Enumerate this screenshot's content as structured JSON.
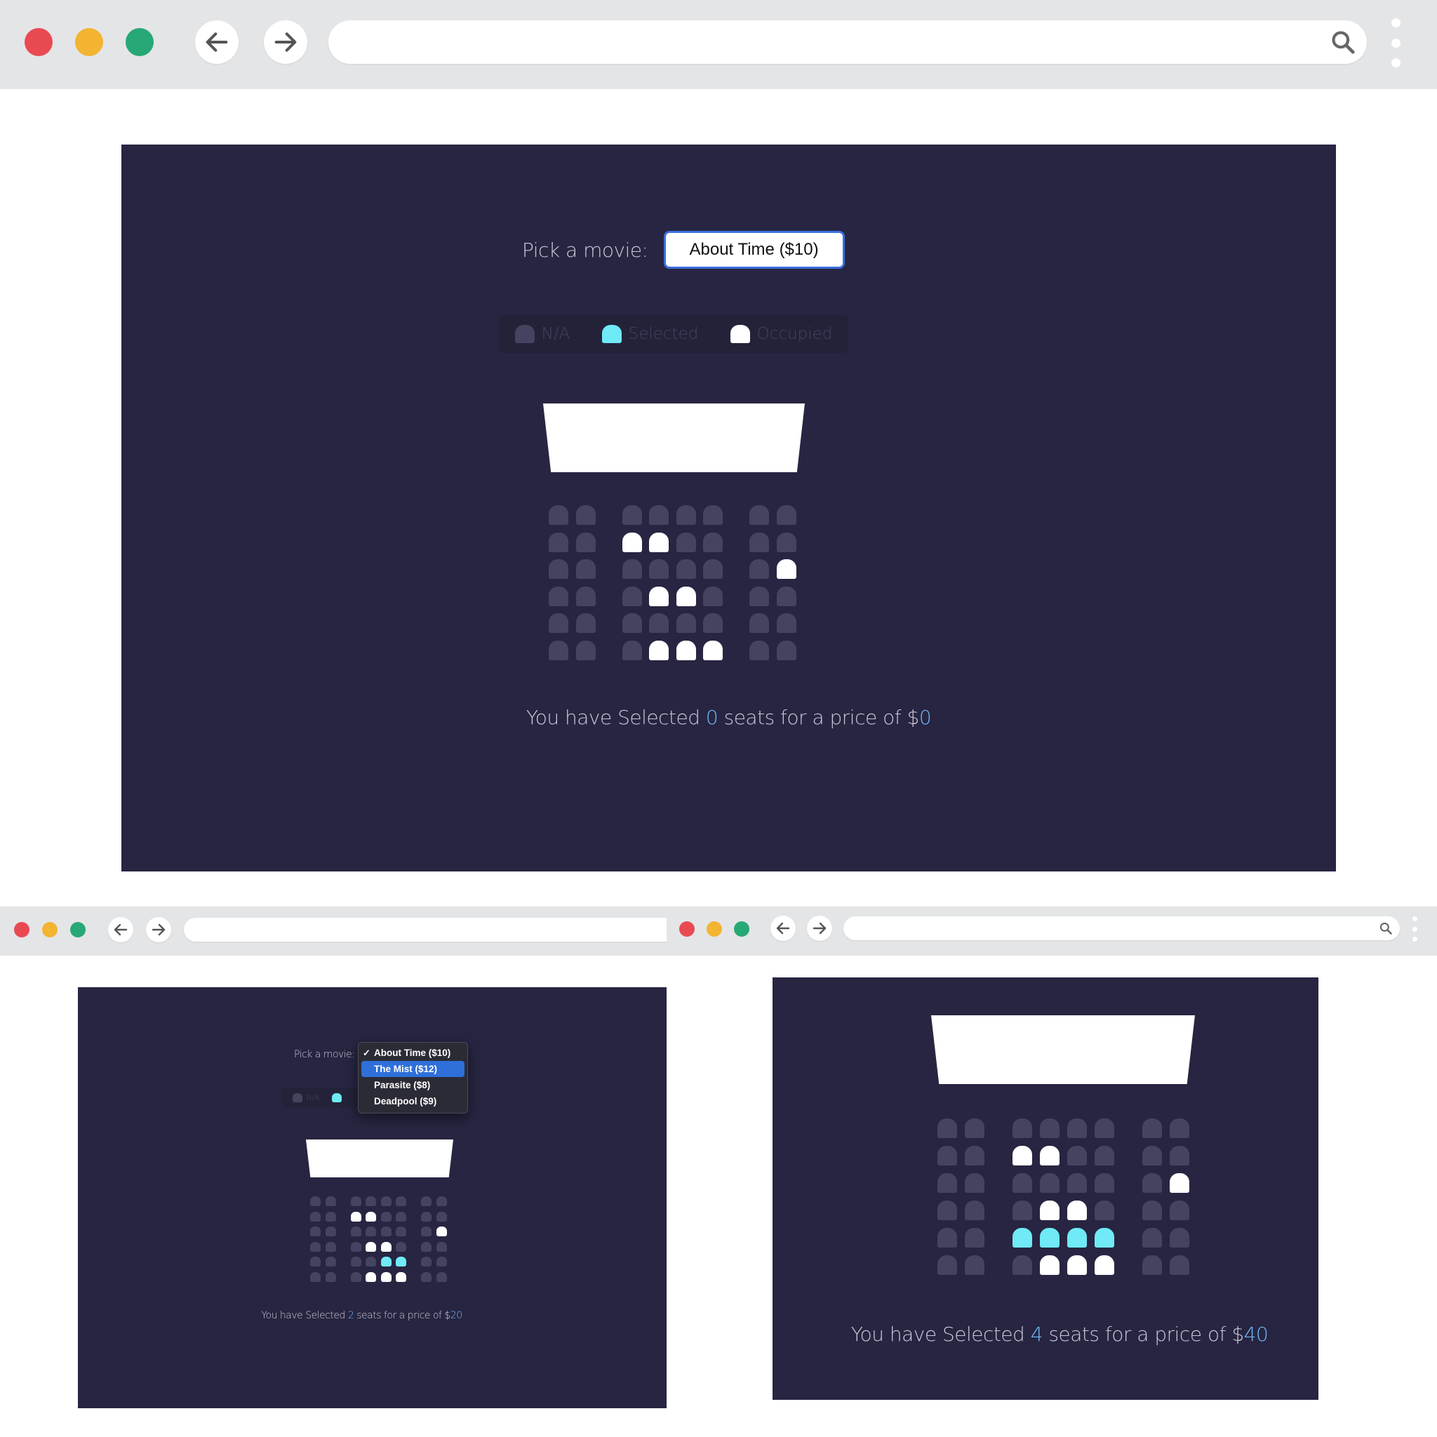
{
  "colors": {
    "close": "#e94a52",
    "minimize": "#f3b431",
    "maximize": "#27a877",
    "stage_bg": "#272541",
    "seat_na": "#444461",
    "seat_selected": "#6feaf6",
    "seat_occupied": "#ffffff",
    "highlight_text": "#6fb7f6",
    "select_border": "#3a6fe0"
  },
  "icons": {
    "back": "arrow-left-icon",
    "forward": "arrow-right-icon",
    "search": "search-icon",
    "menu": "kebab-menu-icon",
    "check": "checkmark-icon"
  },
  "picker": {
    "label": "Pick a movie:",
    "selected": "About Time ($10)"
  },
  "movie_options": [
    {
      "label": "About Time ($10)",
      "checked": true,
      "highlighted": false
    },
    {
      "label": "The Mist ($12)",
      "checked": false,
      "highlighted": true
    },
    {
      "label": "Parasite ($8)",
      "checked": false,
      "highlighted": false
    },
    {
      "label": "Deadpool ($9)",
      "checked": false,
      "highlighted": false
    }
  ],
  "legend": {
    "na": "N/A",
    "selected": "Selected",
    "occupied": "Occupied"
  },
  "screens": [
    {
      "name": "main",
      "seats": [
        "n,n,n,n,n,n,n,n",
        "n,n,o,o,n,n,n,n",
        "n,n,n,n,n,n,n,o",
        "n,n,n,o,o,n,n,n",
        "n,n,n,n,n,n,n,n",
        "n,n,n,o,o,o,n,n"
      ],
      "summary": {
        "prefix": "You have Selected ",
        "count": "0",
        "mid": " seats for a price of $",
        "price": "0"
      }
    },
    {
      "name": "dropdown-open",
      "seats": [
        "n,n,n,n,n,n,n,n",
        "n,n,o,o,n,n,n,n",
        "n,n,n,n,n,n,n,o",
        "n,n,n,o,o,n,n,n",
        "n,n,n,n,s,s,n,n",
        "n,n,n,o,o,o,n,n"
      ],
      "summary": {
        "prefix": "You have Selected ",
        "count": "2",
        "mid": " seats for a price of $",
        "price": "20"
      }
    },
    {
      "name": "four-selected",
      "seats": [
        "n,n,n,n,n,n,n,n",
        "n,n,o,o,n,n,n,n",
        "n,n,n,n,n,n,n,o",
        "n,n,n,o,o,n,n,n",
        "n,n,s,s,s,s,n,n",
        "n,n,n,o,o,o,n,n"
      ],
      "summary": {
        "prefix": "You have Selected ",
        "count": "4",
        "mid": " seats for a price of $",
        "price": "40"
      }
    }
  ]
}
